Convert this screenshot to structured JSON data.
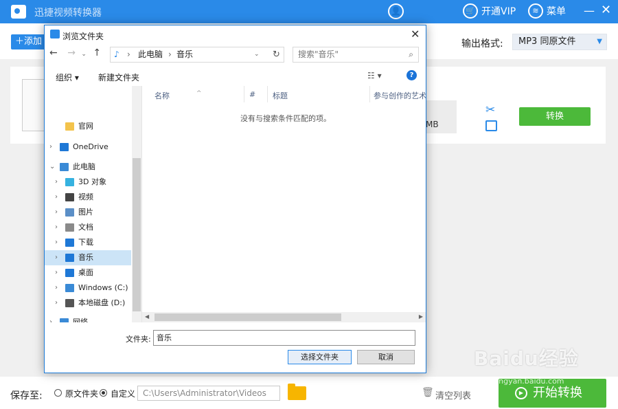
{
  "app": {
    "title": "迅捷视频转换器",
    "vip_label": "开通VIP",
    "menu_label": "菜单",
    "add_label": "添加",
    "output_format_label": "输出格式:",
    "output_format_value": "MP3  同原文件",
    "file_size": "MB",
    "convert_label": "转换",
    "save_to_label": "保存至:",
    "radio_original": "原文件夹",
    "radio_custom": "自定义",
    "save_path": "C:\\Users\\Administrator\\Videos",
    "clear_list_label": "清空列表",
    "start_convert_label": "开始转换"
  },
  "dialog": {
    "title": "浏览文件夹",
    "breadcrumb": [
      "此电脑",
      "音乐"
    ],
    "search_placeholder": "搜索\"音乐\"",
    "organize_label": "组织 ▾",
    "new_folder_label": "新建文件夹",
    "tree": [
      {
        "label": "官网",
        "icon": "folder-icon",
        "color": "#f3c34c"
      },
      {
        "label": "OneDrive",
        "icon": "cloud-icon",
        "color": "#1e78d6"
      },
      {
        "label": "此电脑",
        "icon": "computer-icon",
        "color": "#3a8ad6"
      },
      {
        "label": "3D 对象",
        "icon": "cube-icon",
        "color": "#36b2e0"
      },
      {
        "label": "视频",
        "icon": "film-icon",
        "color": "#444444"
      },
      {
        "label": "图片",
        "icon": "pictures-icon",
        "color": "#5b8fc7"
      },
      {
        "label": "文档",
        "icon": "document-icon",
        "color": "#8a8a8a"
      },
      {
        "label": "下载",
        "icon": "download-icon",
        "color": "#1e78d6"
      },
      {
        "label": "音乐",
        "icon": "music-icon",
        "color": "#1e78d6"
      },
      {
        "label": "桌面",
        "icon": "desktop-icon",
        "color": "#1e78d6"
      },
      {
        "label": "Windows (C:)",
        "icon": "drive-c-icon",
        "color": "#3a8ad6"
      },
      {
        "label": "本地磁盘 (D:)",
        "icon": "drive-d-icon",
        "color": "#555555"
      },
      {
        "label": "网络",
        "icon": "network-icon",
        "color": "#3a8ad6"
      }
    ],
    "columns": [
      "名称",
      "#",
      "标题",
      "参与创作的艺术"
    ],
    "empty_message": "没有与搜索条件匹配的项。",
    "filename_label": "文件夹:",
    "filename_value": "音乐",
    "select_button": "选择文件夹",
    "cancel_button": "取消"
  },
  "watermark": {
    "brand": "Baidu经验",
    "url": "jingyan.baidu.com"
  },
  "colors": {
    "accent": "#2a8ae8",
    "green": "#4cb93a",
    "selection": "#cce4f7"
  }
}
